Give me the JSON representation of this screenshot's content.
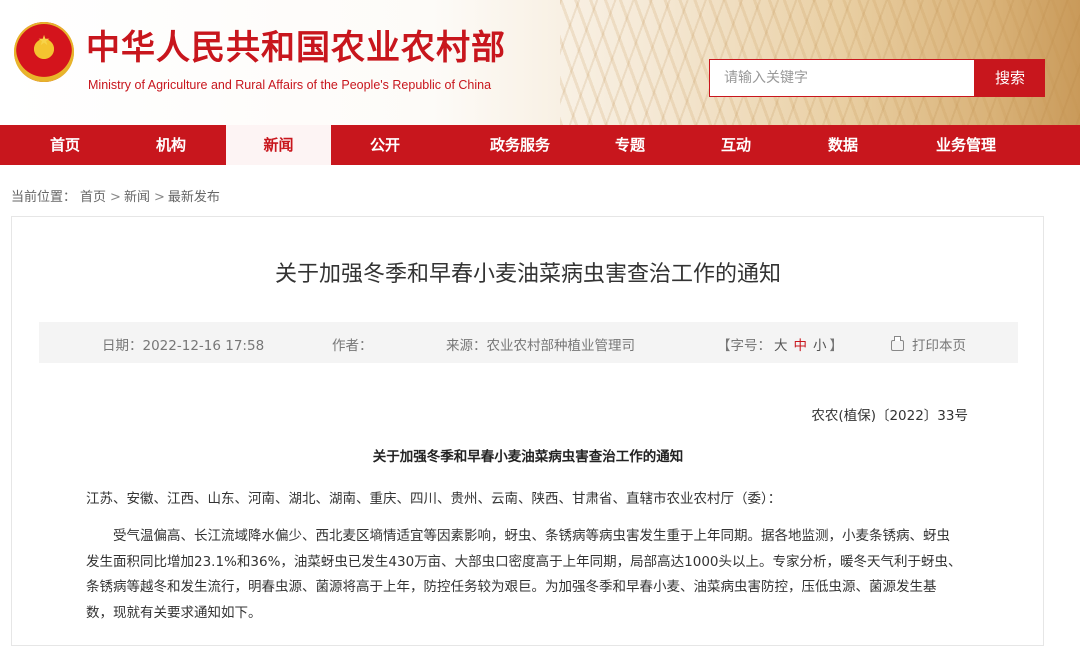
{
  "header": {
    "title": "中华人民共和国农业农村部",
    "subtitle": "Ministry of Agriculture and Rural Affairs of the People's Republic of China",
    "search_placeholder": "请输入关键字",
    "search_button": "搜索",
    "brand_color": "#c8161d"
  },
  "nav": {
    "items": [
      "首页",
      "机构",
      "新闻",
      "公开",
      "政务服务",
      "专题",
      "互动",
      "数据",
      "业务管理"
    ],
    "active": "新闻"
  },
  "breadcrumb": {
    "prefix": "当前位置：",
    "items": [
      "首页",
      "新闻",
      "最新发布"
    ],
    "separator": ">"
  },
  "article": {
    "title": "关于加强冬季和早春小麦油菜病虫害查治工作的通知",
    "meta": {
      "date_label": "日期：",
      "date": "2022-12-16 17:58",
      "author_label": "作者：",
      "author": "",
      "source_label": "来源：",
      "source": "农业农村部种植业管理司",
      "font_size_label": "【字号：",
      "font_size_options": [
        "大",
        "中",
        "小"
      ],
      "font_size_active": "中",
      "font_size_close": "】",
      "print_label": "打印本页"
    },
    "doc_number": "农农(植保)〔2022〕33号",
    "doc_heading": "关于加强冬季和早春小麦油菜病虫害查治工作的通知",
    "recipients": "江苏、安徽、江西、山东、河南、湖北、湖南、重庆、四川、贵州、云南、陕西、甘肃省、直辖市农业农村厅（委）：",
    "paragraph_lines": [
      "受气温偏高、长江流域降水偏少、西北麦区墒情适宜等因素影响，蚜虫、条锈病等病虫害发生重于上年同期。据各地监测，小麦条锈病、蚜虫",
      "发生面积同比增加23.1%和36%，油菜蚜虫已发生430万亩、大部虫口密度高于上年同期，局部高达1000头以上。专家分析，暖冬天气利于蚜虫、",
      "条锈病等越冬和发生流行，明春虫源、菌源将高于上年，防控任务较为艰巨。为加强冬季和早春小麦、油菜病虫害防控，压低虫源、菌源发生基",
      "数，现就有关要求通知如下。"
    ]
  }
}
